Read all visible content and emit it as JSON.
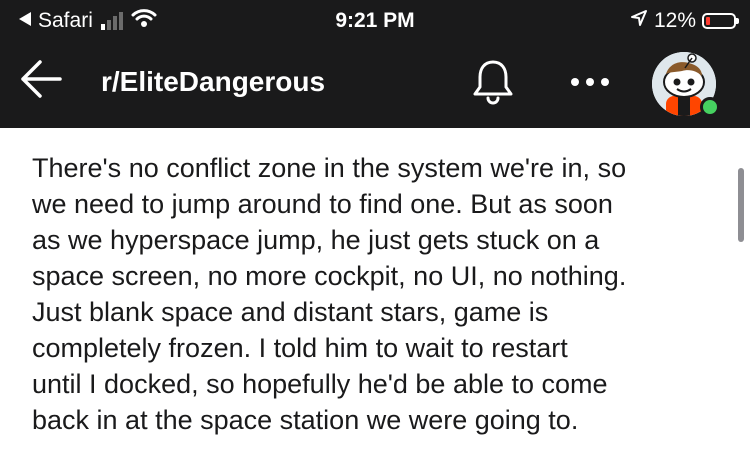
{
  "status_bar": {
    "back_app": "Safari",
    "time": "9:21 PM",
    "battery_percent": "12%",
    "signal_bars_filled": 1,
    "signal_bars_total": 4
  },
  "header": {
    "title": "r/EliteDangerous"
  },
  "post": {
    "body": "There's no conflict zone in the system we're in, so\nwe need to jump around to find one. But as soon\nas we hyperspace jump, he just gets stuck on a\nspace screen, no more cockpit, no UI, no nothing.\nJust blank space and distant stars, game is\ncompletely frozen. I told him to wait to restart\nuntil I docked, so hopefully he'd be able to come\nback in at the space station we were going to."
  },
  "colors": {
    "header_bg": "#1a1a1b",
    "online": "#46d160",
    "battery_low": "#ff3b30"
  }
}
